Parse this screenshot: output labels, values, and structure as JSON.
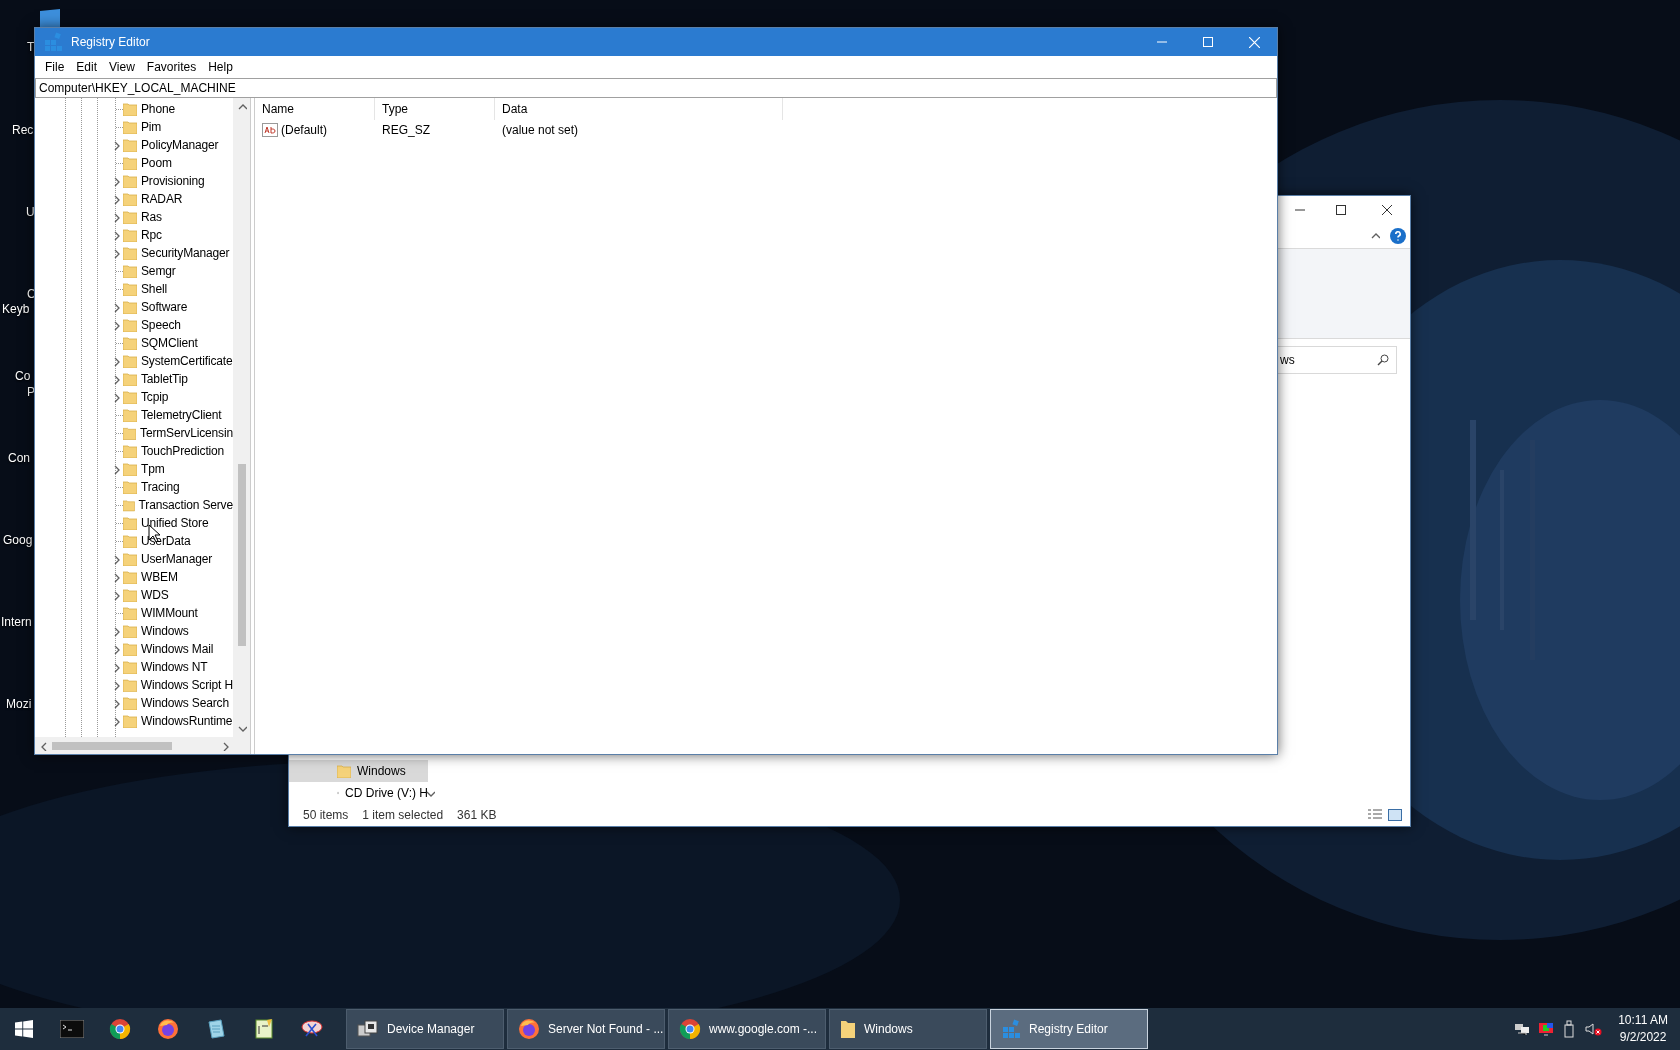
{
  "desktop": {
    "labels": [
      {
        "text": "T"
      },
      {
        "text": "Rec"
      },
      {
        "text": "U"
      },
      {
        "text": "C"
      },
      {
        "text": "Keyb"
      },
      {
        "text": "Co"
      },
      {
        "text": "P"
      },
      {
        "text": "Con"
      },
      {
        "text": "Goog"
      },
      {
        "text": "Intern"
      },
      {
        "text": "Mozi"
      }
    ]
  },
  "registry_editor": {
    "title": "Registry Editor",
    "menu": [
      "File",
      "Edit",
      "View",
      "Favorites",
      "Help"
    ],
    "address": "Computer\\HKEY_LOCAL_MACHINE",
    "tree": [
      {
        "label": "Phone",
        "expandable": false
      },
      {
        "label": "Pim",
        "expandable": false
      },
      {
        "label": "PolicyManager",
        "expandable": true
      },
      {
        "label": "Poom",
        "expandable": false
      },
      {
        "label": "Provisioning",
        "expandable": true
      },
      {
        "label": "RADAR",
        "expandable": true
      },
      {
        "label": "Ras",
        "expandable": true
      },
      {
        "label": "Rpc",
        "expandable": true
      },
      {
        "label": "SecurityManager",
        "expandable": true
      },
      {
        "label": "Semgr",
        "expandable": false
      },
      {
        "label": "Shell",
        "expandable": false
      },
      {
        "label": "Software",
        "expandable": true
      },
      {
        "label": "Speech",
        "expandable": true
      },
      {
        "label": "SQMClient",
        "expandable": false
      },
      {
        "label": "SystemCertificate",
        "expandable": true
      },
      {
        "label": "TabletTip",
        "expandable": true
      },
      {
        "label": "Tcpip",
        "expandable": true
      },
      {
        "label": "TelemetryClient",
        "expandable": false
      },
      {
        "label": "TermServLicensin",
        "expandable": false
      },
      {
        "label": "TouchPrediction",
        "expandable": false
      },
      {
        "label": "Tpm",
        "expandable": true
      },
      {
        "label": "Tracing",
        "expandable": false
      },
      {
        "label": "Transaction Serve",
        "expandable": false
      },
      {
        "label": "Unified Store",
        "expandable": false
      },
      {
        "label": "UserData",
        "expandable": false
      },
      {
        "label": "UserManager",
        "expandable": true
      },
      {
        "label": "WBEM",
        "expandable": true
      },
      {
        "label": "WDS",
        "expandable": true
      },
      {
        "label": "WIMMount",
        "expandable": false
      },
      {
        "label": "Windows",
        "expandable": true
      },
      {
        "label": "Windows Mail",
        "expandable": true
      },
      {
        "label": "Windows NT",
        "expandable": true
      },
      {
        "label": "Windows Script H",
        "expandable": true
      },
      {
        "label": "Windows Search",
        "expandable": true
      },
      {
        "label": "WindowsRuntime",
        "expandable": true
      }
    ],
    "columns": [
      "Name",
      "Type",
      "Data"
    ],
    "rows": [
      {
        "name": "(Default)",
        "type": "REG_SZ",
        "data": "(value not set)"
      }
    ]
  },
  "explorer": {
    "search_value": "ws",
    "nav": [
      {
        "label": "Windows",
        "selected": true,
        "kind": "folder"
      },
      {
        "label": "CD Drive (V:) H",
        "selected": false,
        "kind": "drive"
      }
    ],
    "status": [
      "50 items",
      "1 item selected",
      "361 KB"
    ]
  },
  "taskbar": {
    "pinned": [
      {
        "kind": "terminal"
      },
      {
        "kind": "chrome"
      },
      {
        "kind": "firefox"
      },
      {
        "kind": "notepad"
      },
      {
        "kind": "editor"
      },
      {
        "kind": "snip"
      }
    ],
    "tasks": [
      {
        "label": "Device Manager",
        "kind": "device",
        "active": false
      },
      {
        "label": "Server Not Found - ...",
        "kind": "firefox",
        "active": false
      },
      {
        "label": "www.google.com -...",
        "kind": "chrome",
        "active": false
      },
      {
        "label": "Windows",
        "kind": "folder",
        "active": false
      },
      {
        "label": "Registry Editor",
        "kind": "registry",
        "active": true
      }
    ],
    "clock": {
      "time": "10:11 AM",
      "date": "9/2/2022"
    }
  }
}
